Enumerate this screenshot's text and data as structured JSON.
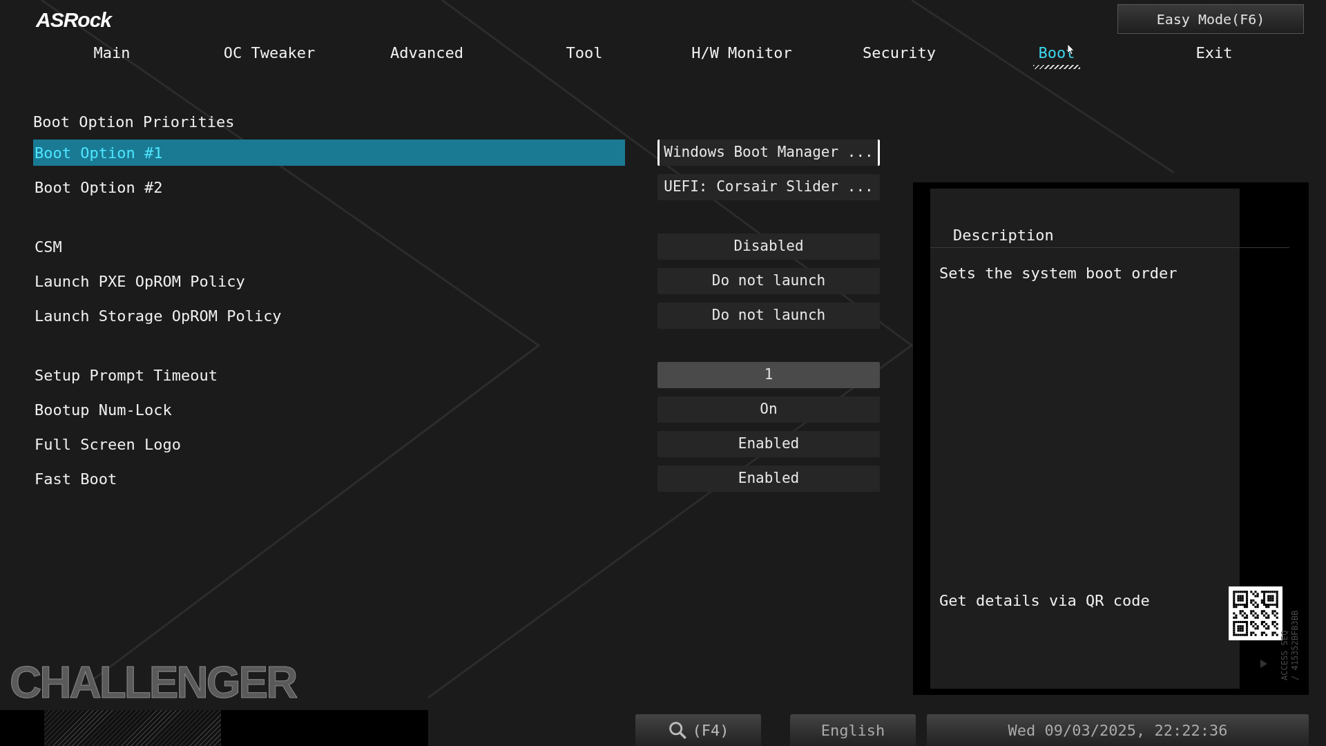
{
  "logo": "ASRock",
  "easy_mode_button": "Easy Mode(F6)",
  "tabs": [
    {
      "label": "Main",
      "selected": false
    },
    {
      "label": "OC Tweaker",
      "selected": false
    },
    {
      "label": "Advanced",
      "selected": false
    },
    {
      "label": "Tool",
      "selected": false
    },
    {
      "label": "H/W Monitor",
      "selected": false
    },
    {
      "label": "Security",
      "selected": false
    },
    {
      "label": "Boot",
      "selected": true
    },
    {
      "label": "Exit",
      "selected": false
    }
  ],
  "section_title": "Boot Option Priorities",
  "groups": [
    [
      {
        "label": "Boot Option #1",
        "value": "Windows Boot Manager ...",
        "kind": "select",
        "selected": true
      },
      {
        "label": "Boot Option #2",
        "value": "UEFI: Corsair Slider ...",
        "kind": "select",
        "selected": false
      }
    ],
    [
      {
        "label": "CSM",
        "value": "Disabled",
        "kind": "select",
        "selected": false
      },
      {
        "label": "Launch PXE OpROM Policy",
        "value": "Do not launch",
        "kind": "select",
        "selected": false
      },
      {
        "label": "Launch Storage OpROM Policy",
        "value": "Do not launch",
        "kind": "select",
        "selected": false
      }
    ],
    [
      {
        "label": "Setup Prompt Timeout",
        "value": "1",
        "kind": "number",
        "selected": false
      },
      {
        "label": "Bootup Num-Lock",
        "value": "On",
        "kind": "select",
        "selected": false
      },
      {
        "label": "Full Screen Logo",
        "value": "Enabled",
        "kind": "select",
        "selected": false
      },
      {
        "label": "Fast Boot",
        "value": "Enabled",
        "kind": "select",
        "selected": false
      }
    ]
  ],
  "description": {
    "title": "Description",
    "text": "Sets the system boot order",
    "qr_caption": "Get details via QR code",
    "side_code": [
      "ACCESS SEQ",
      "/ 415352BFB3BB"
    ]
  },
  "brand_logo": "CHALLENGER",
  "status_bar": {
    "search_button": "(F4)",
    "language_button": "English",
    "datetime": "Wed 09/03/2025, 22:22:36"
  }
}
